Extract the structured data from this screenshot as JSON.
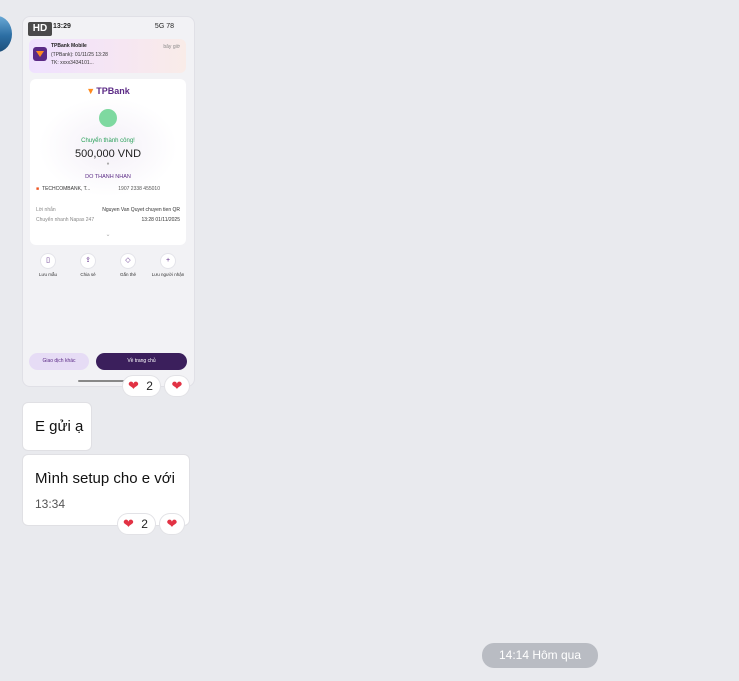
{
  "image_badge": "HD",
  "phone": {
    "status_time": "13:29",
    "status_right": "5G 78",
    "notification": {
      "title": "TPBank Mobile",
      "line1": "(TPBank): 01/11/25 13:28",
      "line2": "TK: xxxx3434101...",
      "time": "bây giờ"
    },
    "card": {
      "logo": "TPBank",
      "status": "Chuyển thành công!",
      "amount": "500,000 VND",
      "recipient": "DO THANH NHAN",
      "bank": "TECHCOMBANK, T...",
      "account": "1907 2338 455010",
      "rows": [
        {
          "label": "Lời nhắn",
          "value": "Nguyen Van Quyet chuyen tien QR"
        },
        {
          "label": "Chuyển nhanh Napas 247",
          "value": "13:28 01/11/2025"
        }
      ]
    },
    "actions": [
      {
        "label": "Lưu mẫu"
      },
      {
        "label": "Chia sẻ"
      },
      {
        "label": "Gắn thẻ"
      },
      {
        "label": "Lưu người nhận"
      }
    ],
    "btn_other": "Giao dịch khác",
    "btn_home": "Về trang chủ"
  },
  "reaction1": {
    "count": "2"
  },
  "messages": [
    {
      "text": "E gửi ạ"
    },
    {
      "text": "Mình setup cho e với",
      "time": "13:34"
    }
  ],
  "reaction2": {
    "count": "2"
  },
  "date_separator": "14:14 Hôm qua"
}
